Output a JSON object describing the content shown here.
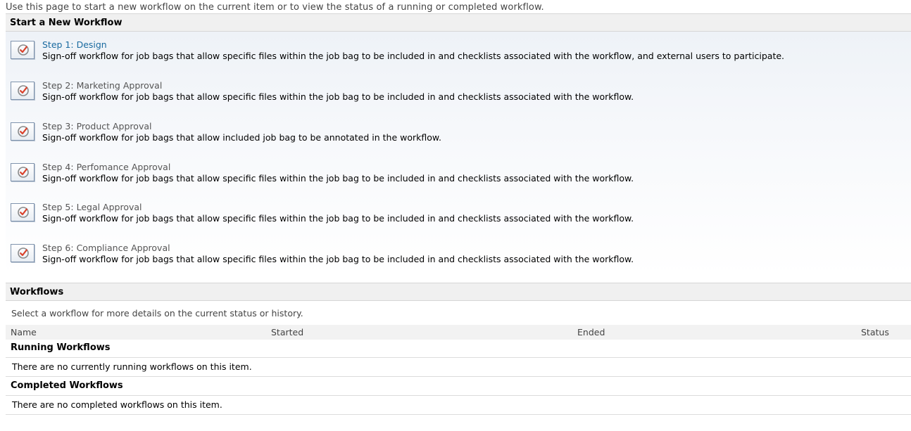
{
  "intro_text": "Use this page to start a new workflow on the current item or to view the status of a running or completed workflow.",
  "start_section": {
    "title": "Start a New Workflow",
    "icon": "workflow-checkmark-icon",
    "items": [
      {
        "title": "Step 1: Design",
        "description": "Sign-off workflow for job bags that allow specific files within the job bag to be included in and checklists associated with the workflow, and external users to participate."
      },
      {
        "title": "Step 2: Marketing Approval",
        "description": "Sign-off workflow for job bags that allow specific files within the job bag to be included in and checklists associated with the workflow."
      },
      {
        "title": "Step 3: Product Approval",
        "description": "Sign-off workflow for job bags that allow included job bag to be annotated in the workflow."
      },
      {
        "title": "Step 4: Perfomance Approval",
        "description": "Sign-off workflow for job bags that allow specific files within the job bag to be included in and checklists associated with the workflow."
      },
      {
        "title": "Step 5: Legal Approval",
        "description": "Sign-off workflow for job bags that allow specific files within the job bag to be included in and checklists associated with the workflow."
      },
      {
        "title": "Step 6: Compliance Approval",
        "description": "Sign-off workflow for job bags that allow specific files within the job bag to be included in and checklists associated with the workflow."
      }
    ]
  },
  "workflows_section": {
    "title": "Workflows",
    "select_text": "Select a workflow for more details on the current status or history.",
    "columns": [
      "Name",
      "Started",
      "Ended",
      "Status"
    ],
    "running": {
      "title": "Running Workflows",
      "empty_text": "There are no currently running workflows on this item."
    },
    "completed": {
      "title": "Completed Workflows",
      "empty_text": "There are no completed workflows on this item."
    }
  },
  "colors": {
    "link": "#1a6aa0",
    "header_bg": "#f0f0f0",
    "icon_check": "#d9412b"
  }
}
